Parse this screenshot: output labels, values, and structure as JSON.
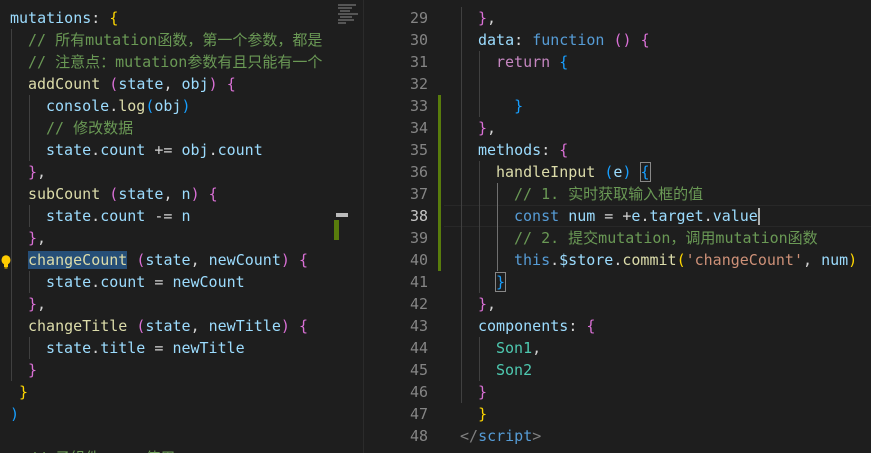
{
  "left": {
    "lines": [
      {
        "indent": 0,
        "tokens": [
          [
            "prop",
            "mutations"
          ],
          [
            "pl",
            ": "
          ],
          [
            "b1",
            "{"
          ]
        ]
      },
      {
        "indent": 1,
        "tokens": [
          [
            "cmt",
            "// 所有mutation函数，第一个参数，都是"
          ]
        ]
      },
      {
        "indent": 1,
        "tokens": [
          [
            "cmt",
            "// 注意点：mutation参数有且只能有一个"
          ]
        ]
      },
      {
        "indent": 1,
        "tokens": [
          [
            "func",
            "addCount"
          ],
          [
            "pl",
            " "
          ],
          [
            "b2",
            "("
          ],
          [
            "prop",
            "state"
          ],
          [
            "pl",
            ", "
          ],
          [
            "prop",
            "obj"
          ],
          [
            "b2",
            ")"
          ],
          [
            "pl",
            " "
          ],
          [
            "b2",
            "{"
          ]
        ]
      },
      {
        "indent": 2,
        "tokens": [
          [
            "prop",
            "console"
          ],
          [
            "pl",
            "."
          ],
          [
            "func",
            "log"
          ],
          [
            "b3",
            "("
          ],
          [
            "prop",
            "obj"
          ],
          [
            "b3",
            ")"
          ]
        ]
      },
      {
        "indent": 2,
        "tokens": [
          [
            "cmt",
            "// 修改数据"
          ]
        ]
      },
      {
        "indent": 2,
        "tokens": [
          [
            "prop",
            "state"
          ],
          [
            "pl",
            "."
          ],
          [
            "prop",
            "count"
          ],
          [
            "pl",
            " += "
          ],
          [
            "prop",
            "obj"
          ],
          [
            "pl",
            "."
          ],
          [
            "prop",
            "count"
          ]
        ]
      },
      {
        "indent": 1,
        "tokens": [
          [
            "b2",
            "}"
          ],
          [
            "pl",
            ","
          ]
        ]
      },
      {
        "indent": 1,
        "tokens": [
          [
            "func",
            "subCount"
          ],
          [
            "pl",
            " "
          ],
          [
            "b2",
            "("
          ],
          [
            "prop",
            "state"
          ],
          [
            "pl",
            ", "
          ],
          [
            "prop",
            "n"
          ],
          [
            "b2",
            ")"
          ],
          [
            "pl",
            " "
          ],
          [
            "b2",
            "{"
          ]
        ]
      },
      {
        "indent": 2,
        "tokens": [
          [
            "prop",
            "state"
          ],
          [
            "pl",
            "."
          ],
          [
            "prop",
            "count"
          ],
          [
            "pl",
            " -= "
          ],
          [
            "prop",
            "n"
          ]
        ]
      },
      {
        "indent": 1,
        "tokens": [
          [
            "b2",
            "}"
          ],
          [
            "pl",
            ","
          ]
        ]
      },
      {
        "indent": 1,
        "bulb": true,
        "tokens": [
          [
            "func sel",
            "changeCount"
          ],
          [
            "pl",
            " "
          ],
          [
            "b2",
            "("
          ],
          [
            "prop",
            "state"
          ],
          [
            "pl",
            ", "
          ],
          [
            "prop",
            "newCount"
          ],
          [
            "b2",
            ")"
          ],
          [
            "pl",
            " "
          ],
          [
            "b2",
            "{"
          ]
        ]
      },
      {
        "indent": 2,
        "tokens": [
          [
            "prop",
            "state"
          ],
          [
            "pl",
            "."
          ],
          [
            "prop",
            "count"
          ],
          [
            "pl",
            " = "
          ],
          [
            "prop",
            "newCount"
          ]
        ]
      },
      {
        "indent": 1,
        "tokens": [
          [
            "b2",
            "}"
          ],
          [
            "pl",
            ","
          ]
        ]
      },
      {
        "indent": 1,
        "tokens": [
          [
            "func",
            "changeTitle"
          ],
          [
            "pl",
            " "
          ],
          [
            "b2",
            "("
          ],
          [
            "prop",
            "state"
          ],
          [
            "pl",
            ", "
          ],
          [
            "prop",
            "newTitle"
          ],
          [
            "b2",
            ")"
          ],
          [
            "pl",
            " "
          ],
          [
            "b2",
            "{"
          ]
        ]
      },
      {
        "indent": 2,
        "tokens": [
          [
            "prop",
            "state"
          ],
          [
            "pl",
            "."
          ],
          [
            "prop",
            "title"
          ],
          [
            "pl",
            " = "
          ],
          [
            "prop",
            "newTitle"
          ]
        ]
      },
      {
        "indent": 1,
        "tokens": [
          [
            "b2",
            "}"
          ]
        ]
      },
      {
        "indent": 0,
        "tokens": [
          [
            "pl",
            " "
          ],
          [
            "b1",
            "}"
          ]
        ]
      },
      {
        "indent": 0,
        "tokens": [
          [
            "b3",
            ")"
          ]
        ]
      },
      {
        "indent": 0,
        "tokens": [
          [
            "pl",
            ""
          ]
        ]
      },
      {
        "indent": 0,
        "tokens": [
          [
            "cmt",
            "  // 子组件 ... 使用"
          ]
        ]
      }
    ]
  },
  "right": {
    "lines": [
      {
        "n": "29",
        "indent": 1,
        "tokens": [
          [
            "b2",
            "}"
          ],
          [
            "pl",
            ","
          ]
        ]
      },
      {
        "n": "30",
        "indent": 1,
        "tokens": [
          [
            "prop",
            "data"
          ],
          [
            "pl",
            ": "
          ],
          [
            "kw",
            "function"
          ],
          [
            "pl",
            " "
          ],
          [
            "b2",
            "("
          ],
          [
            "b2",
            ")"
          ],
          [
            "pl",
            " "
          ],
          [
            "b2",
            "{"
          ]
        ]
      },
      {
        "n": "31",
        "indent": 2,
        "tokens": [
          [
            "kw2",
            "return"
          ],
          [
            "pl",
            " "
          ],
          [
            "b3",
            "{"
          ]
        ]
      },
      {
        "n": "32",
        "indent": 2,
        "tokens": [
          [
            "pl",
            ""
          ]
        ]
      },
      {
        "n": "33",
        "indent": 2,
        "git": true,
        "tokens": [
          [
            "pl",
            "  "
          ],
          [
            "b3",
            "}"
          ]
        ]
      },
      {
        "n": "34",
        "indent": 1,
        "git": true,
        "tokens": [
          [
            "b2",
            "}"
          ],
          [
            "pl",
            ","
          ]
        ]
      },
      {
        "n": "35",
        "indent": 1,
        "git": true,
        "tokens": [
          [
            "prop",
            "methods"
          ],
          [
            "pl",
            ": "
          ],
          [
            "b2",
            "{"
          ]
        ]
      },
      {
        "n": "36",
        "indent": 2,
        "git": true,
        "tokens": [
          [
            "func",
            "handleInput"
          ],
          [
            "pl",
            " "
          ],
          [
            "b3",
            "("
          ],
          [
            "prop",
            "e"
          ],
          [
            "b3",
            ")"
          ],
          [
            "pl",
            " "
          ],
          [
            "b3 box",
            "{"
          ]
        ]
      },
      {
        "n": "37",
        "indent": 3,
        "git": true,
        "tokens": [
          [
            "cmt",
            "// 1. 实时获取输入框的值"
          ]
        ]
      },
      {
        "n": "38",
        "indent": 3,
        "git": true,
        "active": true,
        "cursor": true,
        "tokens": [
          [
            "kw",
            "const"
          ],
          [
            "pl",
            " "
          ],
          [
            "prop",
            "num"
          ],
          [
            "pl",
            " = +"
          ],
          [
            "prop",
            "e"
          ],
          [
            "pl",
            "."
          ],
          [
            "prop",
            "target"
          ],
          [
            "pl",
            "."
          ],
          [
            "prop",
            "value"
          ]
        ]
      },
      {
        "n": "39",
        "indent": 3,
        "git": true,
        "tokens": [
          [
            "cmt",
            "// 2. 提交mutation，调用mutation函数"
          ]
        ]
      },
      {
        "n": "40",
        "indent": 3,
        "git": true,
        "tokens": [
          [
            "kw",
            "this"
          ],
          [
            "pl",
            "."
          ],
          [
            "prop",
            "$store"
          ],
          [
            "pl",
            "."
          ],
          [
            "func",
            "commit"
          ],
          [
            "b1",
            "("
          ],
          [
            "str",
            "'changeCount'"
          ],
          [
            "pl",
            ", "
          ],
          [
            "prop",
            "num"
          ],
          [
            "b1",
            ")"
          ]
        ]
      },
      {
        "n": "41",
        "indent": 2,
        "tokens": [
          [
            "b3 box",
            "}"
          ]
        ]
      },
      {
        "n": "42",
        "indent": 1,
        "tokens": [
          [
            "b2",
            "}"
          ],
          [
            "pl",
            ","
          ]
        ]
      },
      {
        "n": "43",
        "indent": 1,
        "tokens": [
          [
            "prop",
            "components"
          ],
          [
            "pl",
            ": "
          ],
          [
            "b2",
            "{"
          ]
        ]
      },
      {
        "n": "44",
        "indent": 2,
        "tokens": [
          [
            "type",
            "Son1"
          ],
          [
            "pl",
            ","
          ]
        ]
      },
      {
        "n": "45",
        "indent": 2,
        "tokens": [
          [
            "type",
            "Son2"
          ]
        ]
      },
      {
        "n": "46",
        "indent": 1,
        "tokens": [
          [
            "b2",
            "}"
          ]
        ]
      },
      {
        "n": "47",
        "indent": 0,
        "tokens": [
          [
            "pl",
            "  "
          ],
          [
            "b1",
            "}"
          ]
        ]
      },
      {
        "n": "48",
        "indent": 0,
        "tokens": [
          [
            "tag",
            "</"
          ],
          [
            "tagname",
            "script"
          ],
          [
            "tag",
            ">"
          ]
        ]
      }
    ]
  },
  "colors": {
    "background": "#1e1e1e",
    "gitbar": "#587c0c",
    "selection": "#264f78"
  }
}
